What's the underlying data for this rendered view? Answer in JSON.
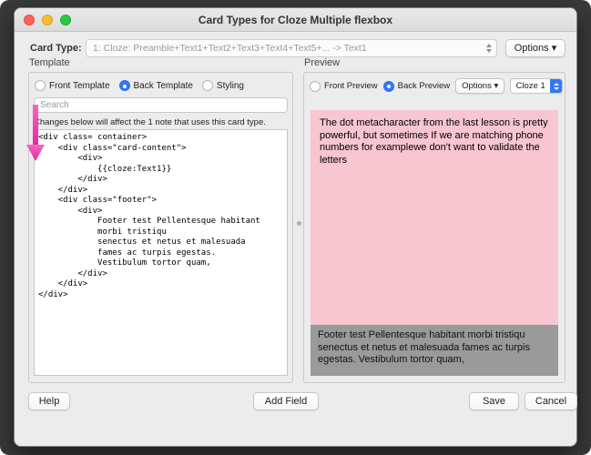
{
  "window": {
    "title": "Card Types for Cloze Multiple flexbox"
  },
  "card_type": {
    "label": "Card Type:",
    "value": "1: Cloze: Preamble+Text1+Text2+Text3+Text4+Text5+... -> Text1",
    "options_button": "Options ▾"
  },
  "template": {
    "title": "Template",
    "radios": [
      {
        "label": "Front Template",
        "selected": false
      },
      {
        "label": "Back Template",
        "selected": true
      },
      {
        "label": "Styling",
        "selected": false
      }
    ],
    "search_placeholder": "Search",
    "note": "Changes below will affect the 1 note that uses this card type.",
    "code": "<div class= container>\n    <div class=\"card-content\">\n        <div>\n            {{cloze:Text1}}\n        </div>\n    </div>\n    <div class=\"footer\">\n        <div>\n            Footer test Pellentesque habitant\n            morbi tristiqu\n            senectus et netus et malesuada\n            fames ac turpis egestas.\n            Vestibulum tortor quam,\n        </div>\n    </div>\n</div>"
  },
  "preview": {
    "title": "Preview",
    "radios": [
      {
        "label": "Front Preview",
        "selected": false
      },
      {
        "label": "Back Preview",
        "selected": true
      }
    ],
    "options_button": "Options ▾",
    "cloze_selector": "Cloze 1",
    "card_text": "The dot metacharacter from the last lesson is pretty powerful, but sometimes If we are matching phone numbers for examplewe don't want to validate the letters",
    "footer_text": "Footer test Pellentesque habitant morbi tristiqu senectus et netus et malesuada fames ac turpis egestas. Vestibulum tortor quam,",
    "colors": {
      "card_bg": "#f7c6d1",
      "footer_bg": "#9a9a9a",
      "accent": "#3478f6",
      "annotation_arrow": "#ee3fae"
    }
  },
  "footer_buttons": {
    "help": "Help",
    "add_field": "Add Field",
    "save": "Save",
    "cancel": "Cancel"
  }
}
